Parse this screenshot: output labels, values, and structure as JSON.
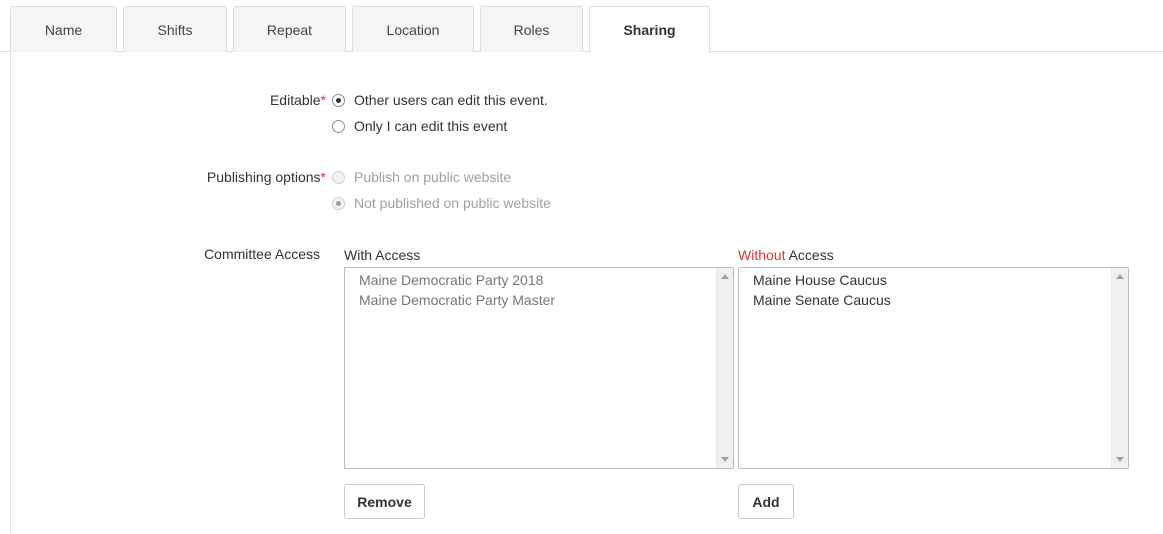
{
  "tabs": [
    {
      "label": "Name"
    },
    {
      "label": "Shifts"
    },
    {
      "label": "Repeat"
    },
    {
      "label": "Location"
    },
    {
      "label": "Roles"
    },
    {
      "label": "Sharing",
      "active": true
    }
  ],
  "editable": {
    "label": "Editable",
    "required_mark": "*",
    "options": [
      {
        "label": "Other users can edit this event.",
        "selected": true
      },
      {
        "label": "Only I can edit this event",
        "selected": false
      }
    ]
  },
  "publishing": {
    "label": "Publishing options",
    "required_mark": "*",
    "disabled": true,
    "options": [
      {
        "label": "Publish on public website",
        "selected": false
      },
      {
        "label": "Not published on public website",
        "selected": true
      }
    ]
  },
  "committee_access": {
    "label": "Committee Access",
    "with_access": {
      "title": "With Access",
      "items": [
        "Maine Democratic Party 2018",
        "Maine Democratic Party Master"
      ],
      "button_label": "Remove"
    },
    "without_access": {
      "title_neg": "Without",
      "title_rest": " Access",
      "items": [
        "Maine House Caucus",
        "Maine Senate Caucus"
      ],
      "button_label": "Add"
    }
  },
  "colors": {
    "required": "#d9363e",
    "border": "#dddddd",
    "tab_bg": "#f5f5f5"
  }
}
